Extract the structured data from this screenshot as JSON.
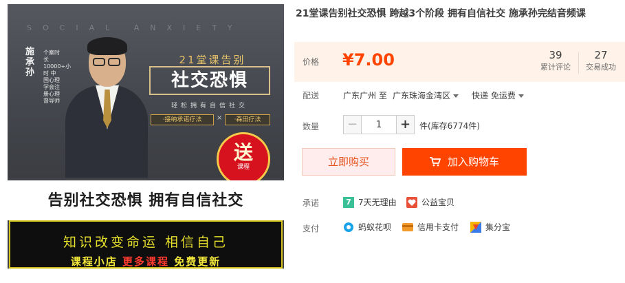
{
  "gallery": {
    "bg_caption": "SOCIAL ANXIETY",
    "teacher_name": "施承孙",
    "teacher_desc": "个案时长10000+小时 中国心理学会注册心理督导师",
    "subtitle": "21堂课告别",
    "main_title": "社交恐惧",
    "tagline": "轻松拥有自信社交",
    "method_1": "·接纳承诺疗法",
    "method_x": "×",
    "method_2": "·森田疗法",
    "gift_big": "送",
    "gift_small": "课程",
    "slogan": "告别社交恐惧 拥有自信社交",
    "promo_line1": "知识改变命运  相信自己",
    "promo_shop": "课程小店",
    "promo_more": "更多课程",
    "promo_free": "免费更新"
  },
  "product": {
    "title": "21堂课告别社交恐惧 跨越3个阶段 拥有自信社交 施承孙完结音频课",
    "price_label": "价格",
    "price": "¥7.00",
    "reviews_count": "39",
    "reviews_label": "累计评论",
    "deals_count": "27",
    "deals_label": "交易成功"
  },
  "shipping": {
    "label": "配送",
    "from": "广东广州 至",
    "to": "广东珠海金湾区",
    "method": "快递 免运费"
  },
  "quantity": {
    "label": "数量",
    "minus": "−",
    "value": "1",
    "plus": "+",
    "stock": "件(库存6774件)"
  },
  "actions": {
    "buy_now": "立即购买",
    "add_to_cart": "加入购物车"
  },
  "promise": {
    "label": "承诺",
    "return_badge": "7",
    "return_policy": "7天无理由",
    "charity": "公益宝贝"
  },
  "payment": {
    "label": "支付",
    "huabei": "蚂蚁花呗",
    "credit_card": "信用卡支付",
    "jifenbao": "集分宝"
  },
  "colors": {
    "accent": "#ff4400",
    "price_bg": "#fff2e8",
    "buy_bg": "#ffeded"
  }
}
